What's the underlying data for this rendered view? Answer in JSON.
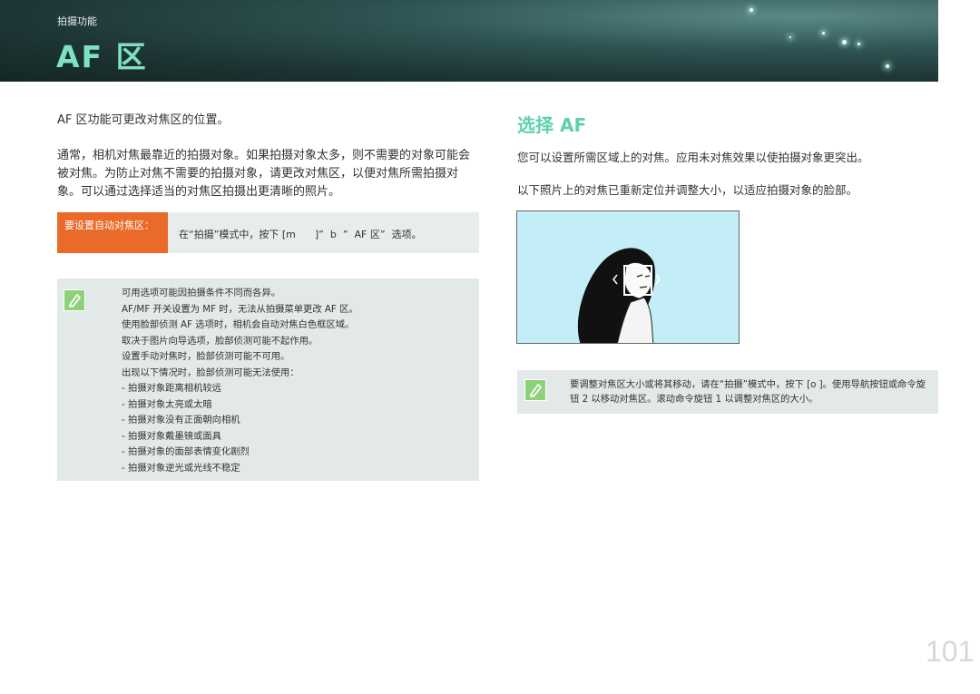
{
  "header": {
    "section": "拍摄功能",
    "title": "AF 区"
  },
  "left": {
    "intro1": "AF 区功能可更改对焦区的位置。",
    "intro2": "通常，相机对焦最靠近的拍摄对象。如果拍摄对象太多，则不需要的对象可能会被对焦。为防止对焦不需要的拍摄对象，请更改对焦区，以便对焦所需拍摄对象。可以通过选择适当的对焦区拍摄出更清晰的照片。",
    "table": {
      "head": "要设置自动对焦区：",
      "cell": "在“拍摄”模式中，按下 [m      ]”  b  ”  AF 区”  选项。"
    },
    "note": {
      "icon": "pencil-note-icon",
      "lines": [
        "可用选项可能因拍摄条件不同而各异。",
        "AF/MF 开关设置为 MF 时，无法从拍摄菜单更改 AF 区。",
        "使用脸部侦测 AF 选项时，相机会自动对焦白色框区域。",
        "取决于图片向导选项，脸部侦测可能不起作用。",
        "设置手动对焦时，脸部侦测可能不可用。",
        "出现以下情况时，脸部侦测可能无法使用：",
        "-  拍摄对象距离相机较远",
        "-  拍摄对象太亮或太暗",
        "-  拍摄对象没有正面朝向相机",
        "-  拍摄对象戴墨镜或面具",
        "-  拍摄对象的面部表情变化剧烈",
        "-  拍摄对象逆光或光线不稳定"
      ]
    }
  },
  "right": {
    "title": "选择 AF",
    "para1": "您可以设置所需区域上的对焦。应用未对焦效果以使拍摄对象更突出。",
    "para2": "以下照片上的对焦已重新定位并调整大小，以适应拍摄对象的脸部。",
    "note": "要调整对焦区大小或将其移动，请在“拍摄”模式中，按下 [o ]。使用导航按钮或命令旋钮 2 以移动对焦区。滚动命令旋钮 1 以调整对焦区的大小。"
  },
  "page_number": "101",
  "colors": {
    "accent": "#5fd0b0",
    "table_head": "#ea6a2a",
    "note_bg": "#e3e8e9",
    "icon_green": "#8fd17a"
  }
}
